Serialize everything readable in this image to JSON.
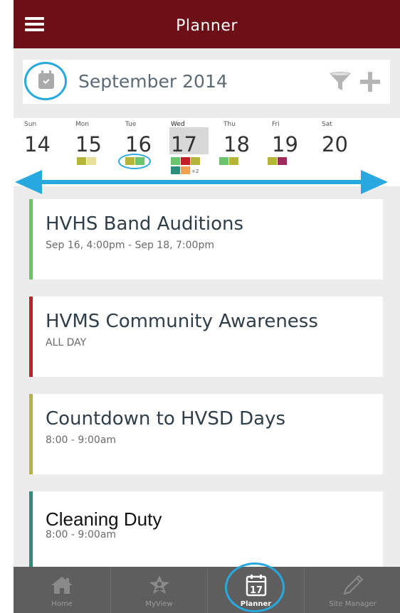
{
  "header": {
    "title": "Planner",
    "menu_icon": "hamburger-menu-icon"
  },
  "month_bar": {
    "month_label": "September 2014",
    "calendar_icon": "calendar-check-icon",
    "filter_icon": "filter-icon",
    "add_icon": "plus-icon"
  },
  "week": {
    "days": [
      {
        "dow": "Sun",
        "num": "14",
        "dots": []
      },
      {
        "dow": "Mon",
        "num": "15",
        "dots": [
          "#b5b53c",
          "#e8e09a"
        ]
      },
      {
        "dow": "Tue",
        "num": "16",
        "dots": [
          "#b5b53c",
          "#6bc46b"
        ]
      },
      {
        "dow": "Wed",
        "num": "17",
        "dots": [
          "#6bc46b",
          "#c0202a",
          "#b5b53c",
          "#2c8f7c",
          "#f0a050"
        ],
        "more": "+2",
        "selected": true
      },
      {
        "dow": "Thu",
        "num": "18",
        "dots": [
          "#6bc46b",
          "#b5b53c"
        ]
      },
      {
        "dow": "Fri",
        "num": "19",
        "dots": [
          "#b5b53c",
          "#9e2a5c"
        ]
      },
      {
        "dow": "Sat",
        "num": "20",
        "dots": []
      }
    ],
    "swipe_icon": "double-arrow-icon"
  },
  "events": [
    {
      "title": "HVHS Band Auditions",
      "time": "Sep 16, 4:00pm - Sep 18, 7:00pm",
      "color": "#6bc46b"
    },
    {
      "title": "HVMS Community Awareness",
      "time": "ALL DAY",
      "color": "#c0202a"
    },
    {
      "title": "Countdown to HVSD Days",
      "time": "8:00 - 9:00am",
      "color": "#b5b53c"
    },
    {
      "title": "Cleaning Duty",
      "time": "8:00 - 9:00am",
      "color": "#2c8f7c"
    }
  ],
  "nav": {
    "items": [
      {
        "label": "Home",
        "icon": "home-icon"
      },
      {
        "label": "MyView",
        "icon": "star-person-icon"
      },
      {
        "label": "Planner",
        "icon": "calendar-17-icon",
        "active": true,
        "icon_text": "17"
      },
      {
        "label": "Site Manager",
        "icon": "pencil-icon"
      }
    ]
  },
  "colors": {
    "header": "#6c0f17",
    "accent_ring": "#27a9e0",
    "nav_bg": "#5e5e5e",
    "background": "#ececec"
  }
}
